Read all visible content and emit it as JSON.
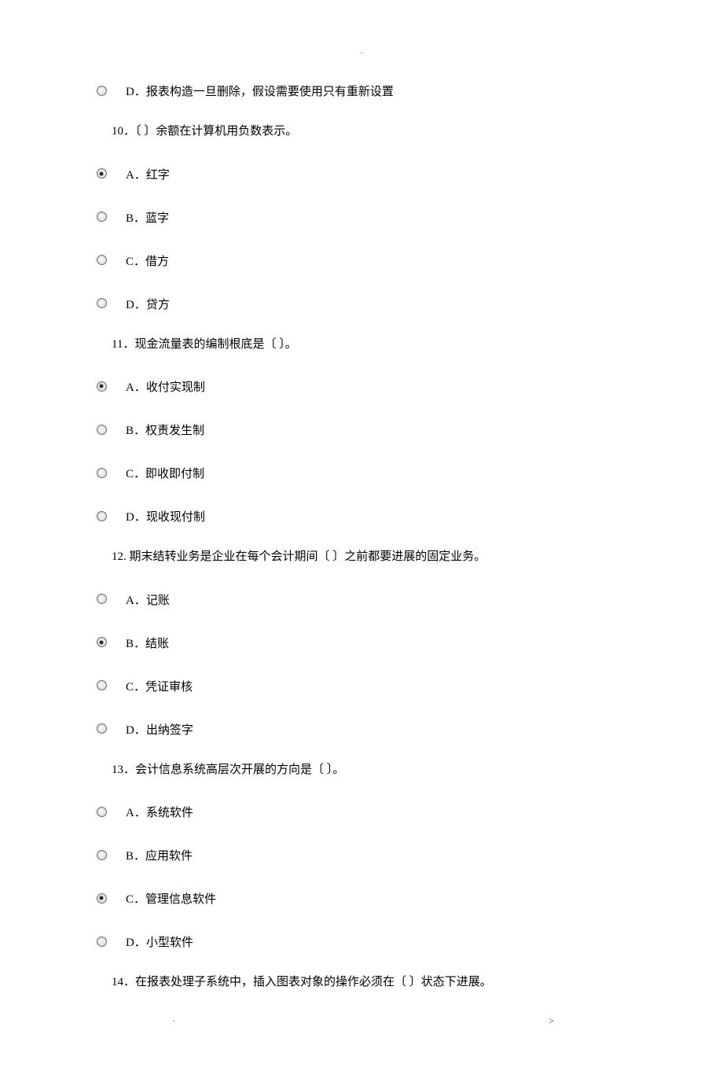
{
  "header_dot": ".",
  "orphan": {
    "option": {
      "label": "D．报表构造一旦删除，假设需要使用只有重新设置",
      "selected": false
    }
  },
  "questions": [
    {
      "prompt": "10．〔   〕余额在计算机用负数表示。",
      "options": [
        {
          "label": "A．红字",
          "selected": true
        },
        {
          "label": "B．蓝字",
          "selected": false
        },
        {
          "label": "C．借方",
          "selected": false
        },
        {
          "label": "D．贷方",
          "selected": false
        }
      ]
    },
    {
      "prompt": "11．现金流量表的编制根底是〔    〕。",
      "options": [
        {
          "label": "A．收付实现制",
          "selected": true
        },
        {
          "label": "B．权责发生制",
          "selected": false
        },
        {
          "label": "C．即收即付制",
          "selected": false
        },
        {
          "label": "D．现收现付制",
          "selected": false
        }
      ]
    },
    {
      "prompt": "12. 期末结转业务是企业在每个会计期间〔   〕之前都要进展的固定业务。",
      "options": [
        {
          "label": "A．记账",
          "selected": false
        },
        {
          "label": "B．结账",
          "selected": true
        },
        {
          "label": "C．凭证审核",
          "selected": false
        },
        {
          "label": "D．出纳签字",
          "selected": false
        }
      ]
    },
    {
      "prompt": "13．会计信息系统高层次开展的方向是〔    〕。",
      "options": [
        {
          "label": "A．系统软件",
          "selected": false
        },
        {
          "label": "B．应用软件",
          "selected": false
        },
        {
          "label": "C．管理信息软件",
          "selected": true
        },
        {
          "label": "D．小型软件",
          "selected": false
        }
      ]
    },
    {
      "prompt": "14．在报表处理子系统中，插入图表对象的操作必须在〔    〕状态下进展。",
      "options": []
    }
  ],
  "footer_left": ".",
  "footer_right": ">"
}
